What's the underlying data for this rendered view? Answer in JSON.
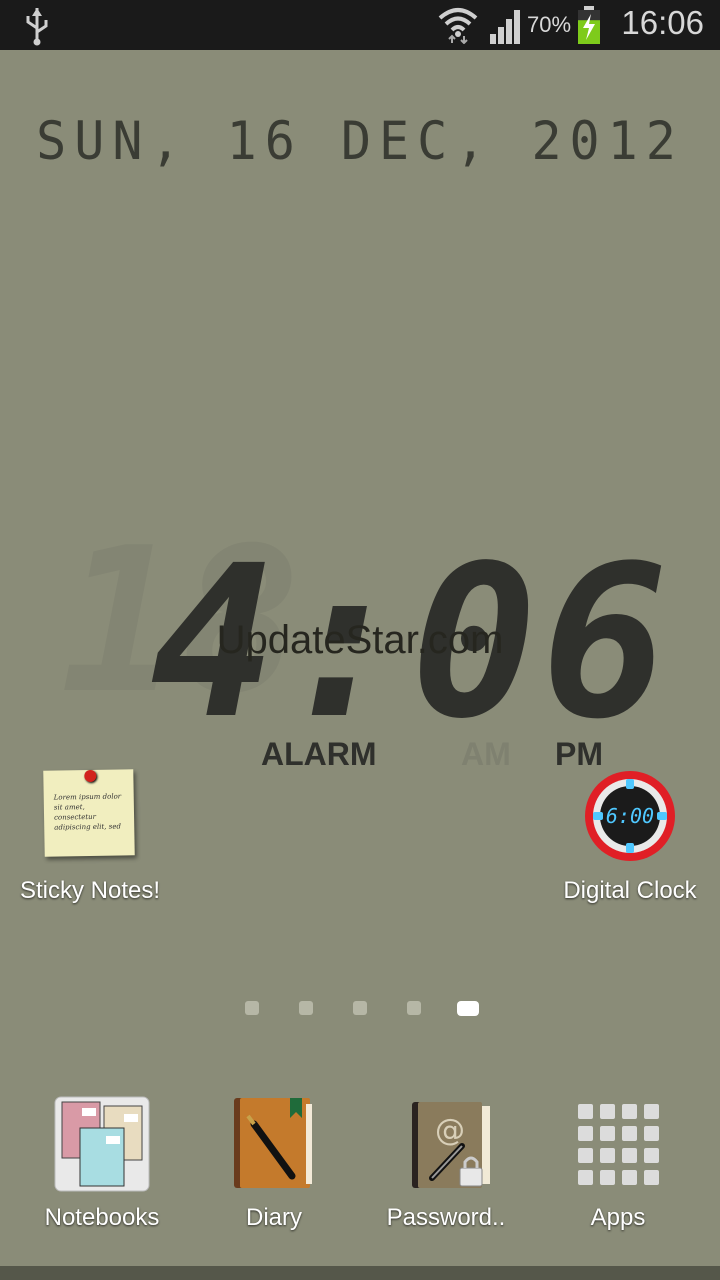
{
  "status_bar": {
    "battery_percent": "70%",
    "time": "16:06",
    "icons": [
      "usb-icon",
      "wifi-icon",
      "signal-icon",
      "battery-charging-icon"
    ],
    "battery_level": 0.7
  },
  "date_widget": {
    "text": "SUN, 16 DEC, 2012"
  },
  "clock_widget": {
    "time": "4:06",
    "ghost_hour": "18",
    "watermark": "UpdateStar.com",
    "alarm_label": "ALARM",
    "am_label": "AM",
    "pm_label": "PM"
  },
  "home_icons": [
    {
      "label": "Sticky Notes!",
      "icon": "sticky-note-icon",
      "note_text": "Lorem ipsum dolor sit amet, consectetur adipiscing elit, sed"
    },
    {
      "label": "Digital Clock",
      "icon": "digital-clock-icon",
      "face_text": "6:00"
    }
  ],
  "page_indicator": {
    "count": 5,
    "active": 5
  },
  "dock": [
    {
      "label": "Notebooks",
      "icon": "notebooks-icon"
    },
    {
      "label": "Diary",
      "icon": "diary-icon"
    },
    {
      "label": "Password..",
      "icon": "password-icon"
    },
    {
      "label": "Apps",
      "icon": "apps-grid-icon"
    }
  ],
  "colors": {
    "wallpaper": "#8a8c78",
    "lcd_segment": "#2f302c",
    "status_bar": "#1a1a1a",
    "clock_ring": "#e01f26",
    "clock_digits": "#4fc8ff"
  }
}
